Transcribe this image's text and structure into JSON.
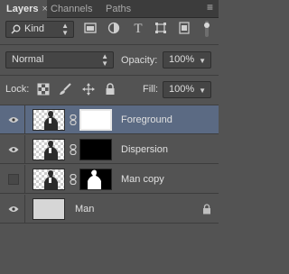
{
  "tabs": [
    {
      "label": "Layers",
      "close": "×"
    },
    {
      "label": "Channels"
    },
    {
      "label": "Paths"
    }
  ],
  "tab_menu_glyph": "≡",
  "filter": {
    "kind_label": "Kind",
    "icons": [
      "image-filter-icon",
      "adjustment-filter-icon",
      "type-filter-icon",
      "shape-filter-icon",
      "smart-object-filter-icon",
      "filter-toggle-icon"
    ],
    "type_glyph": "T"
  },
  "blend": {
    "mode": "Normal",
    "opacity_label": "Opacity:",
    "opacity_value": "100%"
  },
  "lock": {
    "label": "Lock:",
    "fill_label": "Fill:",
    "fill_value": "100%"
  },
  "layers": [
    {
      "name": "Foreground",
      "visible": true,
      "selected": true,
      "mask": "white"
    },
    {
      "name": "Dispersion",
      "visible": true,
      "selected": false,
      "mask": "black"
    },
    {
      "name": "Man copy",
      "visible": false,
      "selected": false,
      "mask": "silhouette"
    },
    {
      "name": "Man",
      "visible": true,
      "selected": false,
      "mask": "none",
      "locked": true
    }
  ],
  "colors": {
    "panel": "#535353",
    "selected": "#5b6a83",
    "tabbar": "#3c3c3c"
  }
}
